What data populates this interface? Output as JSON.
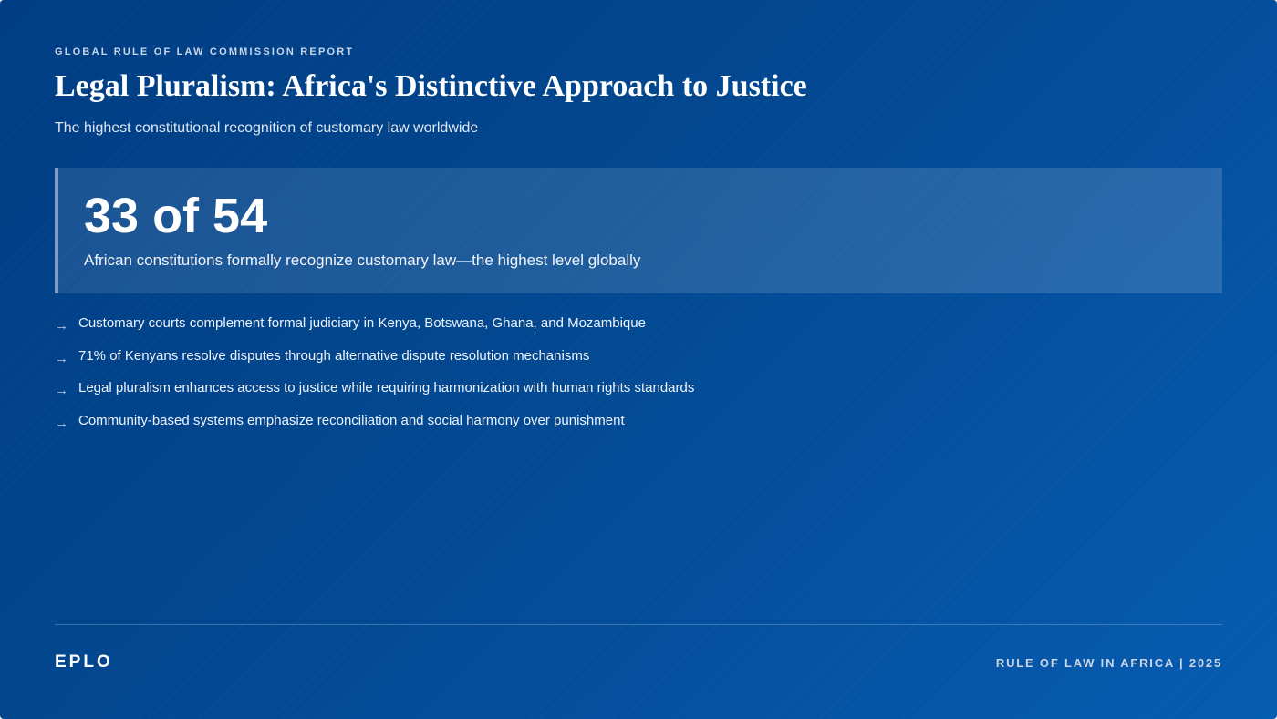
{
  "header": {
    "eyebrow": "GLOBAL RULE OF LAW COMMISSION REPORT",
    "title": "Legal Pluralism: Africa's Distinctive Approach to Justice",
    "subtitle": "The highest constitutional recognition of customary law worldwide"
  },
  "stat": {
    "value": "33 of 54",
    "caption": "African constitutions formally recognize customary law—the highest level globally"
  },
  "points": [
    {
      "icon": "arrow-right-icon",
      "glyph": "→",
      "text": "Customary courts complement formal judiciary in Kenya, Botswana, Ghana, and Mozambique"
    },
    {
      "icon": "arrow-right-icon",
      "glyph": "→",
      "text": "71% of Kenyans resolve disputes through alternative dispute resolution mechanisms"
    },
    {
      "icon": "arrow-right-icon",
      "glyph": "→",
      "text": "Legal pluralism enhances access to justice while requiring harmonization with human rights standards"
    },
    {
      "icon": "arrow-right-icon",
      "glyph": "→",
      "text": "Community-based systems emphasize reconciliation and social harmony over punishment"
    }
  ],
  "footer": {
    "brand": "EPLO",
    "right": "RULE OF LAW IN AFRICA | 2025"
  },
  "colors": {
    "background_start": "#003d84",
    "background_end": "#065cb1",
    "stat_accent": "#7f9cc4",
    "text": "#ffffff"
  }
}
